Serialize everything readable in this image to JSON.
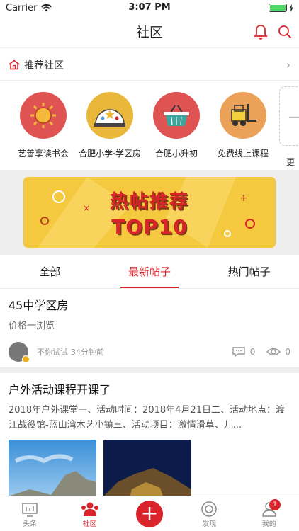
{
  "status_bar": {
    "carrier": "Carrier",
    "time": "3:07 PM"
  },
  "nav": {
    "title": "社区"
  },
  "recommend": {
    "label": "推荐社区"
  },
  "communities": [
    {
      "name": "艺善享读书会",
      "color": "#e05353"
    },
    {
      "name": "合肥小学·学区房",
      "color": "#e9b83a"
    },
    {
      "name": "合肥小升初",
      "color": "#e05353"
    },
    {
      "name": "免费线上课程",
      "color": "#eba157"
    }
  ],
  "community_more": {
    "label": "更"
  },
  "banner": {
    "line1": "热帖推荐",
    "line2": "TOP10"
  },
  "tabs": [
    "全部",
    "最新帖子",
    "热门帖子"
  ],
  "posts": [
    {
      "title": "45中学区房",
      "desc": "价格一浏览",
      "author": "不你试试",
      "time": "34分钟前",
      "comments": "0",
      "views": "0"
    },
    {
      "title": "户外活动课程开课了",
      "desc": "2018年户外课堂一、活动时间：2018年4月21日二、活动地点：渡江战役馆-蓝山湾木艺小镇三、活动项目：激情滑草、儿..."
    }
  ],
  "tabbar": [
    {
      "label": "头条"
    },
    {
      "label": "社区"
    },
    {
      "label": ""
    },
    {
      "label": "发现"
    },
    {
      "label": "我的",
      "badge": "1"
    }
  ],
  "colors": {
    "accent": "#d8242a",
    "banner": "#f5c93f"
  }
}
